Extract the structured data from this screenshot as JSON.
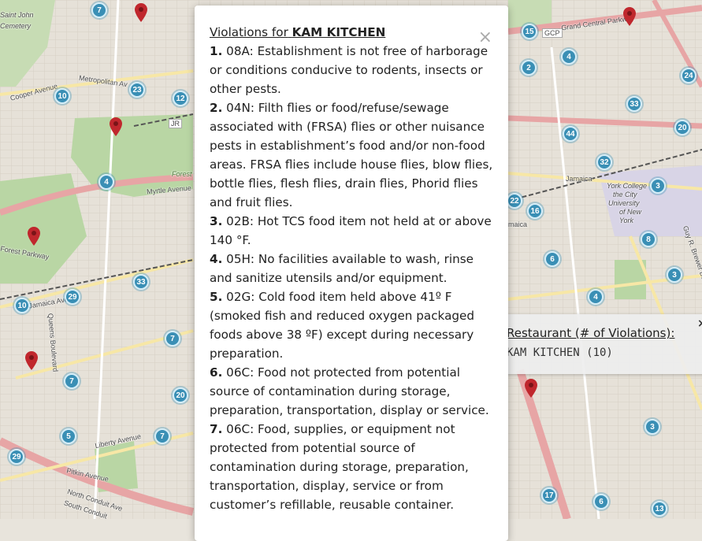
{
  "map": {
    "labels": [
      "Saint John",
      "Cemetery",
      "Cooper Avenue",
      "Metropolitan Av",
      "JR",
      "Forest",
      "Myrtle Avenue",
      "Forest Parkway",
      "Jamaica Avenue",
      "Liberty Avenue",
      "Pitkin Avenue",
      "North Conduit Ave",
      "South Conduit",
      "Queens Boulevard",
      "GCP",
      "Grand Central Parkway",
      "Jamaica",
      "York College",
      "the City",
      "University",
      "of New",
      "York",
      "maica",
      "Guy R. Brewer Boulevard"
    ],
    "clusters": [
      "7",
      "23",
      "10",
      "12",
      "4",
      "33",
      "10",
      "29",
      "7",
      "7",
      "20",
      "5",
      "7",
      "29",
      "15",
      "2",
      "4",
      "33",
      "24",
      "20",
      "44",
      "32",
      "3",
      "22",
      "16",
      "8",
      "3",
      "6",
      "4",
      "3",
      "17",
      "6",
      "13"
    ],
    "colors": {
      "cluster": "#3a8fb5",
      "pin": "#c0272d",
      "park": "#b9d6a4",
      "highway": "#e7a5a5"
    }
  },
  "modal": {
    "title_prefix": "Violations for",
    "restaurant": "KAM KITCHEN",
    "close": "×",
    "violations": [
      {
        "num": "1.",
        "text": "08A: Establishment is not free of harborage or conditions conducive to rodents, insects or other pests."
      },
      {
        "num": "2.",
        "text": "04N: Filth flies or food/refuse/sewage associated with (FRSA) flies or other nuisance pests in establishment’s food and/or non-food areas. FRSA flies include house flies, blow flies, bottle flies, flesh flies, drain flies, Phorid flies and fruit flies."
      },
      {
        "num": "3.",
        "text": "02B: Hot TCS food item not held at or above 140 °F."
      },
      {
        "num": "4.",
        "text": "05H: No facilities available to wash, rinse and sanitize utensils and/or equipment."
      },
      {
        "num": "5.",
        "text": "02G: Cold food item held above 41º F (smoked fish and reduced oxygen packaged foods above 38 ºF) except during necessary preparation."
      },
      {
        "num": "6.",
        "text": "06C: Food not protected from potential source of contamination during storage, preparation, transportation, display or service."
      },
      {
        "num": "7.",
        "text": "06C: Food, supplies, or equipment not protected from potential source of contamination during storage, preparation, transportation, display, service or from customer’s refillable, reusable container."
      }
    ]
  },
  "popup": {
    "header": "Restaurant (# of Violations):",
    "row": "KAM KITCHEN (10)",
    "close": "×"
  }
}
